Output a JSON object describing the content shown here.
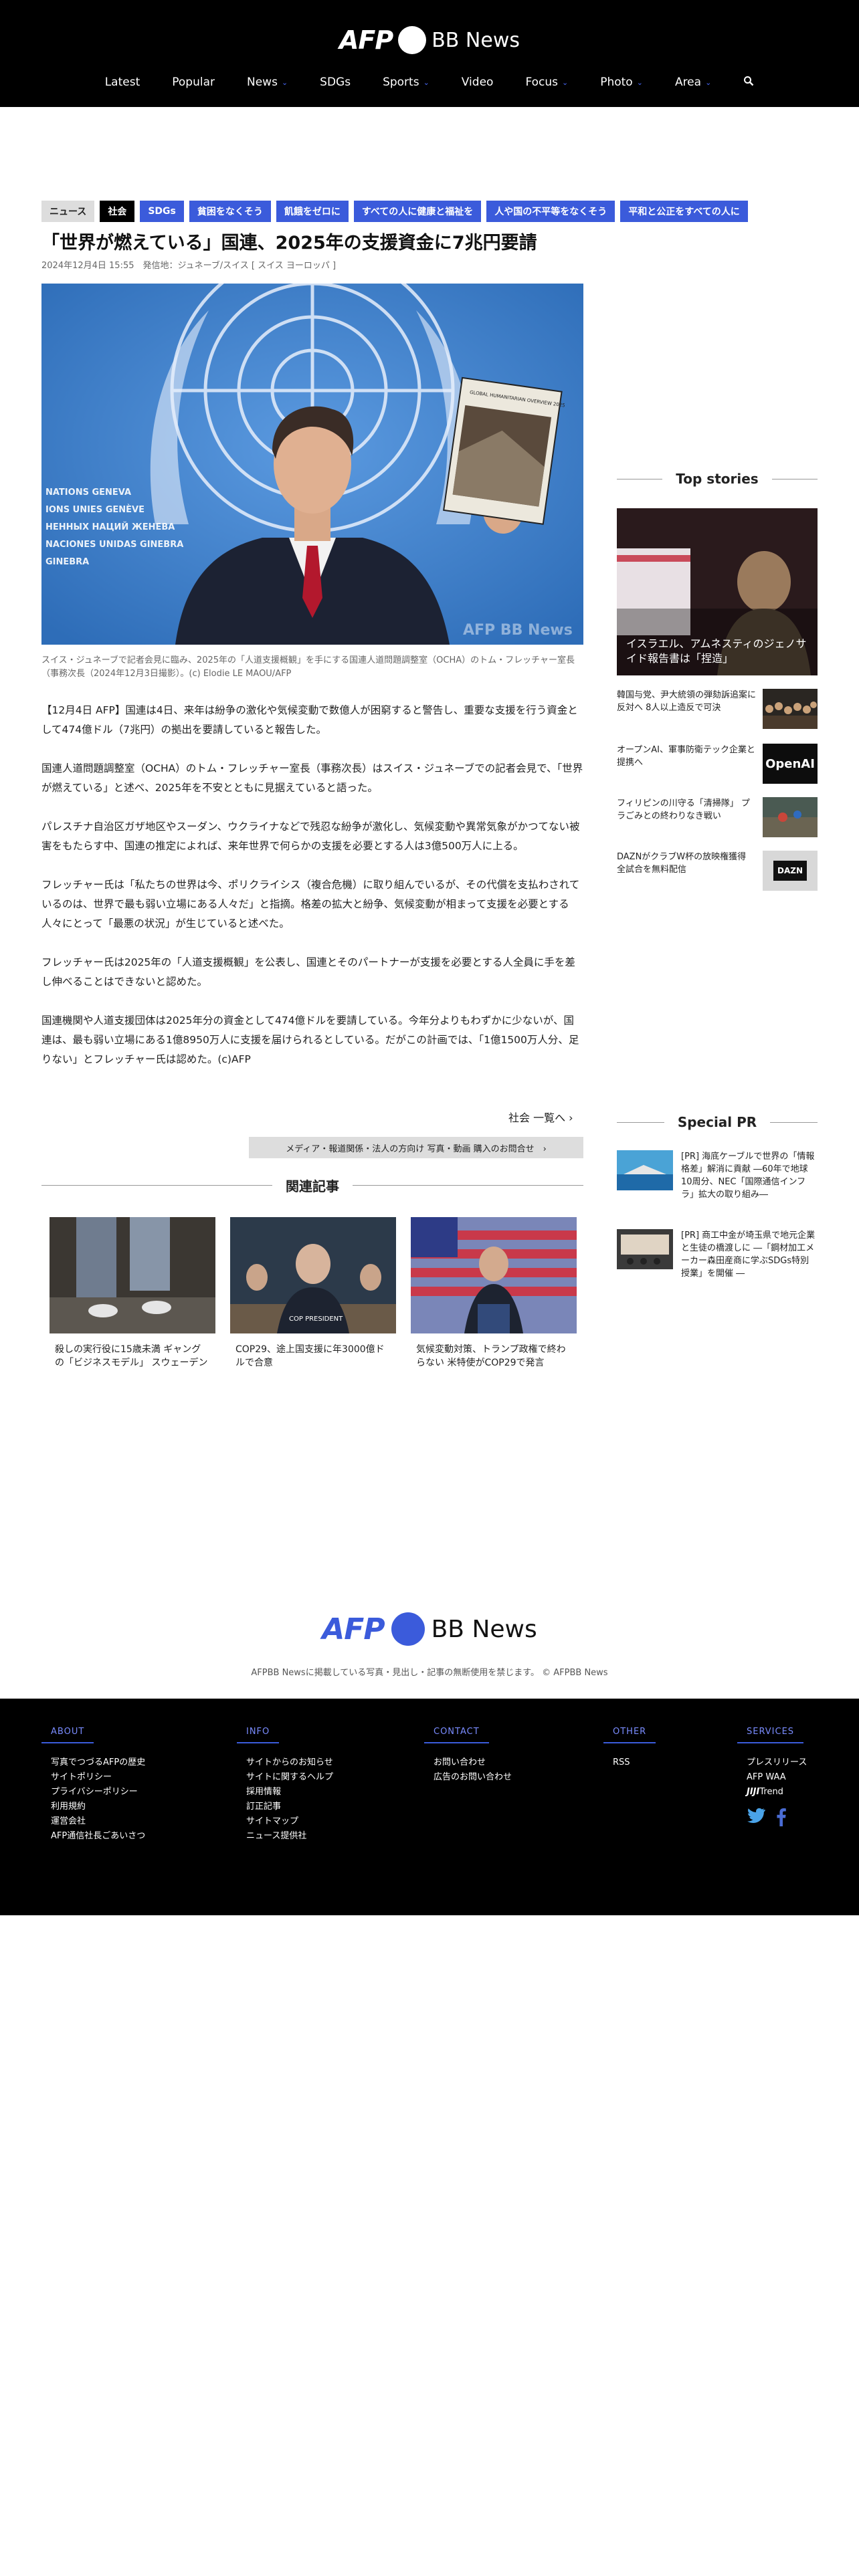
{
  "header": {
    "logo_left": "AFP",
    "logo_right": "BB News",
    "nav": [
      {
        "label": "Latest",
        "caret": ""
      },
      {
        "label": "Popular",
        "caret": ""
      },
      {
        "label": "News",
        "caret": "⌄"
      },
      {
        "label": "SDGs",
        "caret": ""
      },
      {
        "label": "Sports",
        "caret": "⌄"
      },
      {
        "label": "Video",
        "caret": ""
      },
      {
        "label": "Focus",
        "caret": "⌄"
      },
      {
        "label": "Photo",
        "caret": "⌄"
      },
      {
        "label": "Area",
        "caret": "⌄"
      }
    ],
    "search_icon": "search-icon"
  },
  "article": {
    "tags": [
      "ニュース",
      "社会",
      "SDGs",
      "貧困をなくそう",
      "飢餓をゼロに",
      "すべての人に健康と福祉を",
      "人や国の不平等をなくそう",
      "平和と公正をすべての人に"
    ],
    "title": "「世界が燃えている」国連、2025年の支援資金に7兆円要請",
    "meta": "2024年12月4日 15:55　発信地：ジュネーブ/スイス [ スイス ヨーロッパ ]",
    "caption": "スイス・ジュネーブで記者会見に臨み、2025年の「人道支援概観」を手にする国連人道問題調整室（OCHA）のトム・フレッチャー室長（事務次長（2024年12月3日撮影）。(c) Elodie LE MAOU/AFP",
    "paragraphs": [
      "【12月4日 AFP】国連は4日、来年は紛争の激化や気候変動で数億人が困窮すると警告し、重要な支援を行う資金として474億ドル（7兆円）の拠出を要請していると報告した。",
      "国連人道問題調整室（OCHA）のトム・フレッチャー室長（事務次長）はスイス・ジュネーブでの記者会見で、「世界が燃えている」と述べ、2025年を不安とともに見据えていると語った。",
      "パレスチナ自治区ガザ地区やスーダン、ウクライナなどで残忍な紛争が激化し、気候変動や異常気象がかつてない被害をもたらす中、国連の推定によれば、来年世界で何らかの支援を必要とする人は3億500万人に上る。",
      "フレッチャー氏は「私たちの世界は今、ポリクライシス（複合危機）に取り組んでいるが、その代償を支払わされているのは、世界で最も弱い立場にある人々だ」と指摘。格差の拡大と紛争、気候変動が相まって支援を必要とする人々にとって「最悪の状況」が生じていると述べた。",
      "フレッチャー氏は2025年の「人道支援概観」を公表し、国連とそのパートナーが支援を必要とする人全員に手を差し伸べることはできないと認めた。",
      "国連機関や人道支援団体は2025年分の資金として474億ドルを要請している。今年分よりもわずかに少ないが、国連は、最も弱い立場にある1億8950万人に支援を届けられるとしている。だがこの計画では、「1億1500万人分、足りない」とフレッチャー氏は認めた。(c)AFP"
    ],
    "hero_text": {
      "lines": [
        "NATIONS GENEVA",
        "IONS UNIES GENÈVE",
        "НЕННЫХ НАЦИЙ ЖЕНЕВА",
        "NACIONES UNIDAS GINEBRA",
        "GINEBRA"
      ],
      "book_title": "GLOBAL HUMANITARIAN OVERVIEW 2025",
      "watermark": "AFP BB News"
    },
    "more_link": "社会 一覧へ ›",
    "buy_bar": "メディア・報道関係・法人の方向け 写真・動画 購入のお問合せ　›"
  },
  "related": {
    "title": "関連記事",
    "items": [
      {
        "text": "殺しの実行役に15歳未満 ギャングの「ビジネスモデル」 スウェーデン"
      },
      {
        "text": "COP29、途上国支援に年3000億ドルで合意",
        "sign": "COP PRESIDENT"
      },
      {
        "text": "気候変動対策、トランプ政権で終わらない 米特使がCOP29で発言"
      }
    ]
  },
  "sidebar": {
    "top_title": "Top stories",
    "top_hero_text": "イスラエル、アムネスティのジェノサイド報告書は「捏造」",
    "stories": [
      {
        "text": "韓国与党、尹大統領の弾劾訴追案に反対へ 8人以上造反で可決",
        "thumb_icon": "crowd-photo-icon"
      },
      {
        "text": "オープンAI、軍事防衛テック企業と提携へ",
        "thumb_text": "OpenAI"
      },
      {
        "text": "フィリピンの川守る「清掃隊」 プラごみとの終わりなき戦い",
        "thumb_icon": "river-photo-icon"
      },
      {
        "text": "DAZNがクラブW杯の放映権獲得 全試合を無料配信",
        "thumb_text": "DAZN"
      }
    ],
    "pr_title": "Special PR",
    "pr": [
      {
        "text": "[PR] 海底ケーブルで世界の「情報格差」解消に貢献 ―60年で地球10周分、NEC「国際通信インフラ」拡大の取り組み―"
      },
      {
        "text": "[PR] 商工中金が埼玉県で地元企業と生徒の橋渡しに ―「鋼材加工メーカー森田産商に学ぶSDGs特別授業」を開催 ―"
      }
    ]
  },
  "footer": {
    "logo_left": "AFP",
    "logo_right": "BB News",
    "copyright": "AFPBB Newsに掲載している写真・見出し・記事の無断使用を禁じます。 © AFPBB News",
    "about": {
      "heading": "ABOUT",
      "items": [
        "写真でつづるAFPの歴史",
        "サイトポリシー",
        "プライバシーポリシー",
        "利用規約",
        "運営会社",
        "AFP通信社長ごあいさつ"
      ]
    },
    "info": {
      "heading": "INFO",
      "items": [
        "サイトからのお知らせ",
        "サイトに関するヘルプ",
        "採用情報",
        "訂正記事",
        "サイトマップ",
        "ニュース提供社"
      ]
    },
    "contact": {
      "heading": "CONTACT",
      "items": [
        "お問い合わせ",
        "広告のお問い合わせ"
      ]
    },
    "other": {
      "heading": "OTHER",
      "items": [
        "RSS"
      ]
    },
    "services": {
      "heading": "SERVICES",
      "items": [
        "プレスリリース",
        "AFP WAA"
      ],
      "jiji_bold": "JIJI",
      "jiji_rest": "Trend"
    }
  },
  "colors": {
    "accent": "#3b5bdb",
    "header_bg": "#000000",
    "tag_black": "#000000",
    "tag_grey": "#dddddd"
  }
}
